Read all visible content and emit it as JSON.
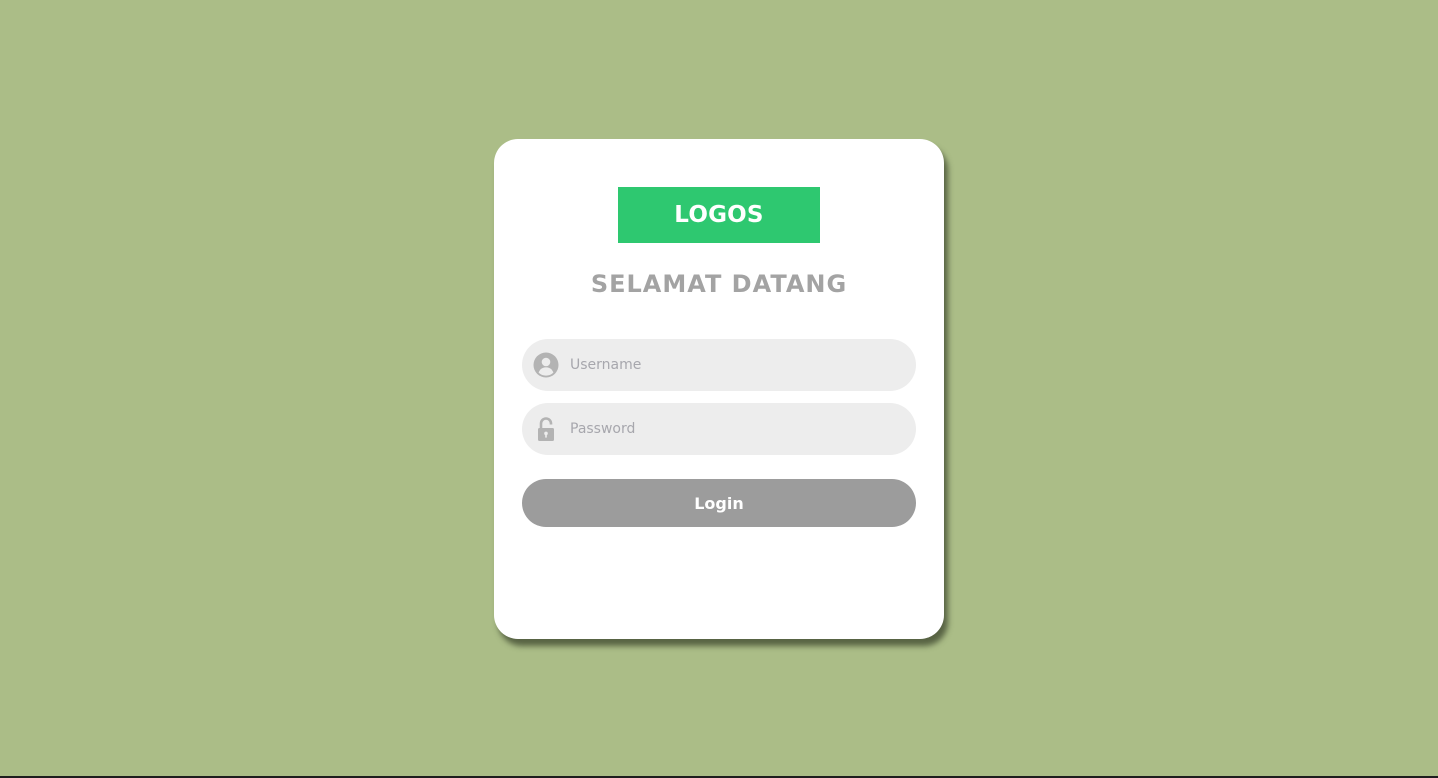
{
  "colors": {
    "background": "#abbd87",
    "card": "#ffffff",
    "logo": "#2ec870",
    "title": "#a3a3a3",
    "field": "#ededed",
    "icon": "#b3b3b3",
    "button": "#9c9c9c"
  },
  "logo": {
    "text": "LOGOS"
  },
  "heading": {
    "title": "SELAMAT DATANG"
  },
  "form": {
    "username": {
      "icon": "user-circle-icon",
      "placeholder": "Username",
      "value": ""
    },
    "password": {
      "icon": "lock-icon",
      "placeholder": "Password",
      "value": ""
    },
    "login_label": "Login"
  }
}
